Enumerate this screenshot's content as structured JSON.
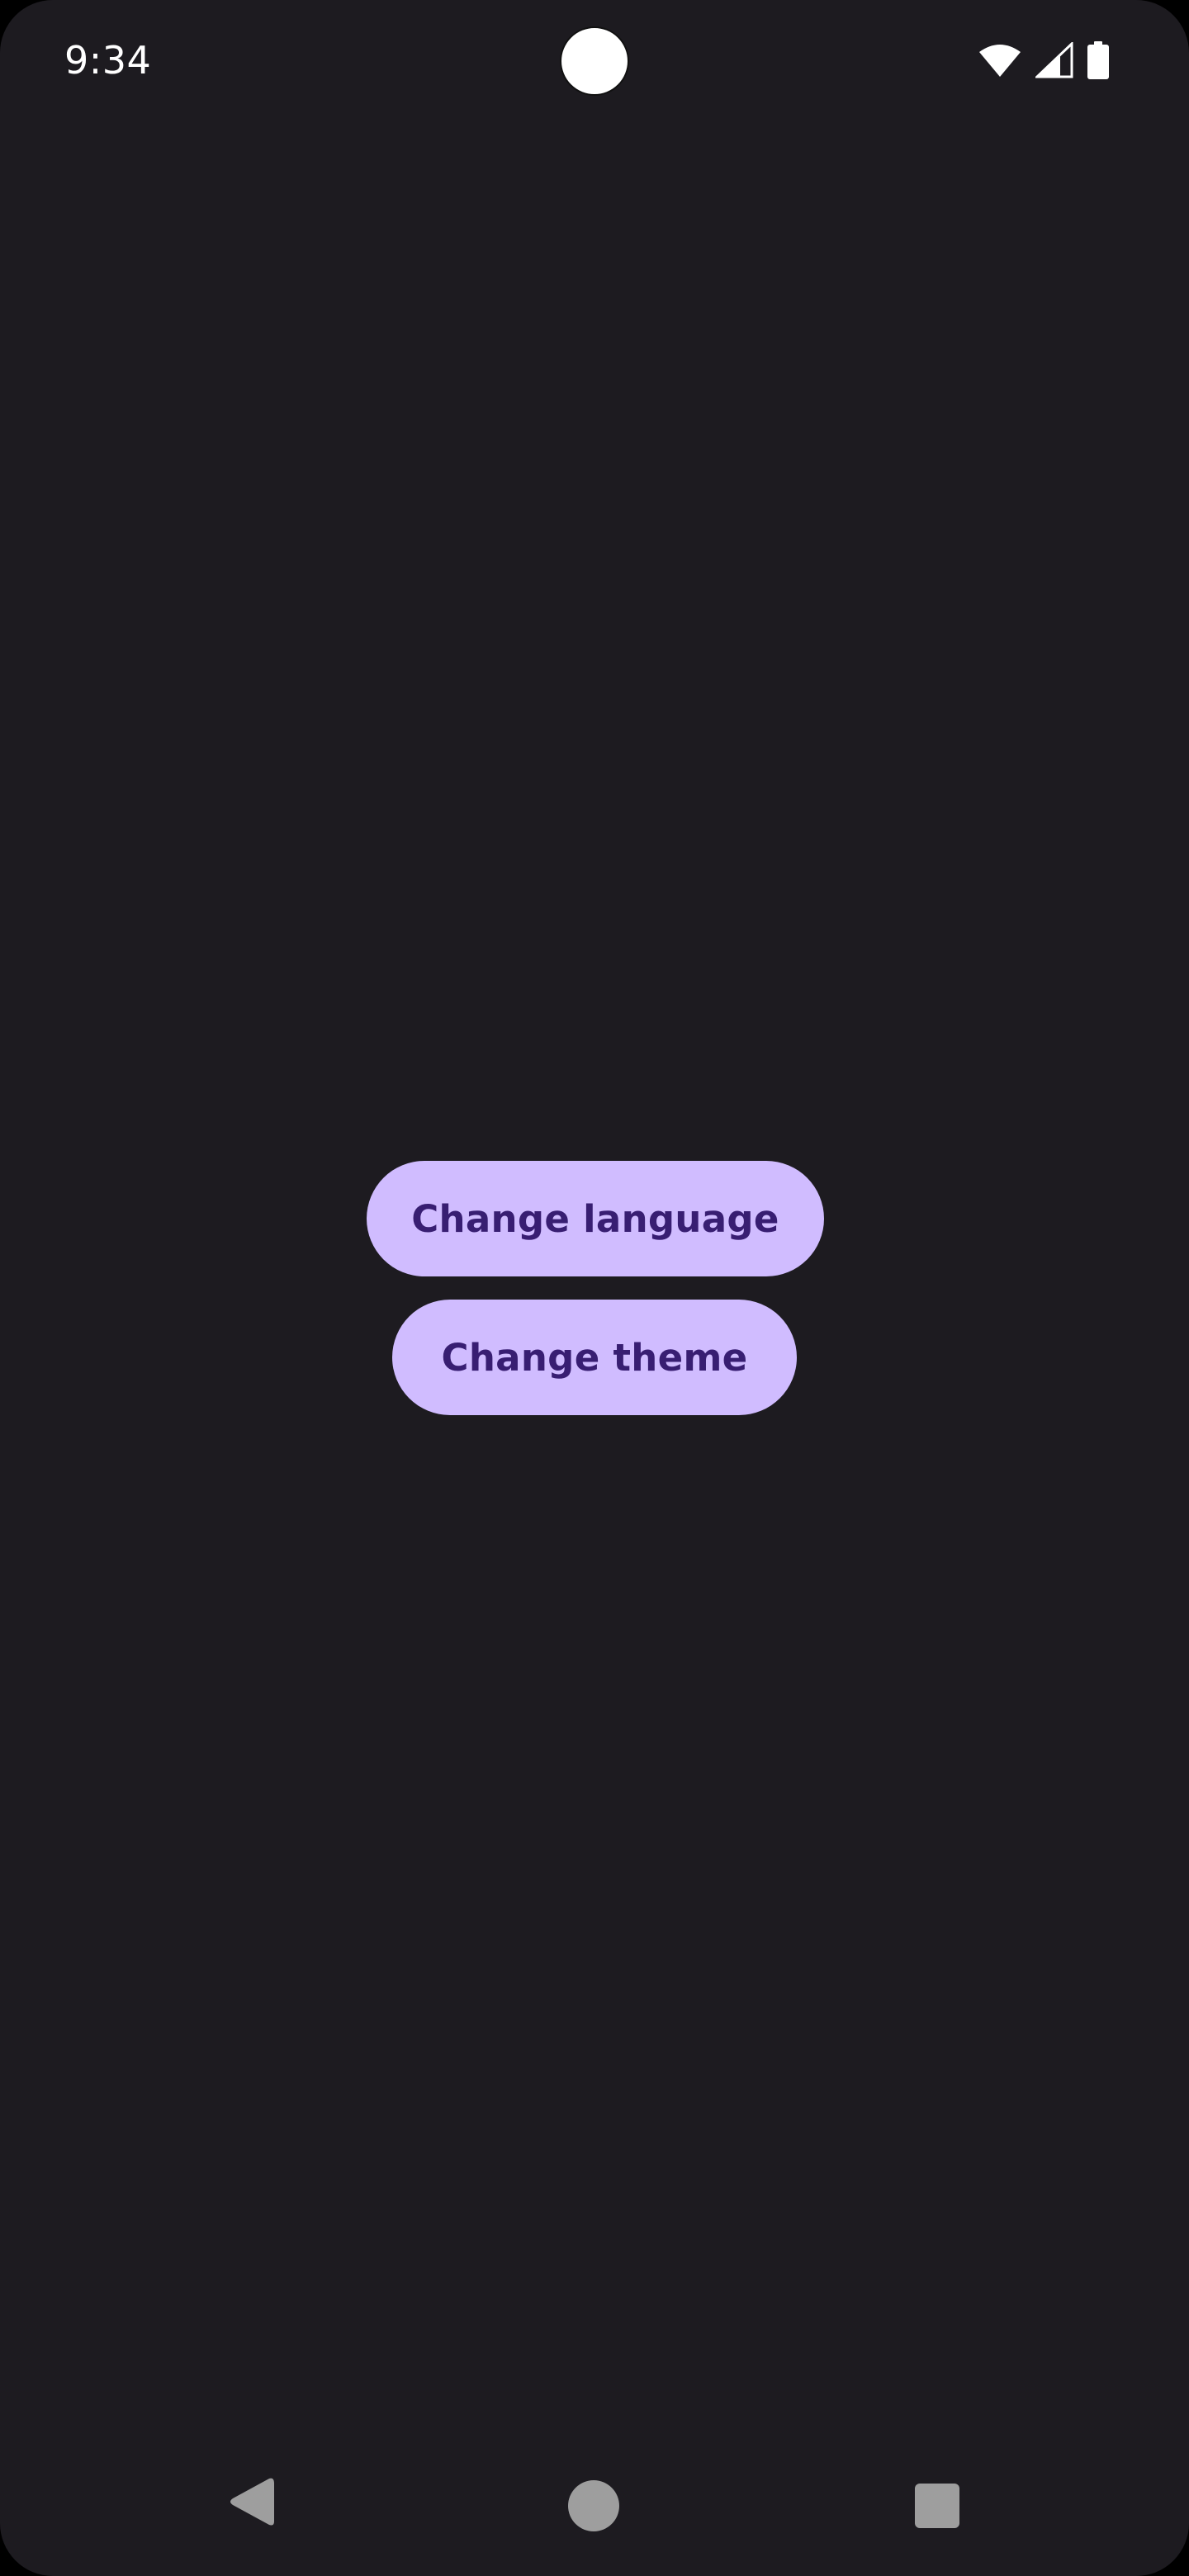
{
  "status_bar": {
    "time": "9:34",
    "icons": [
      "wifi-icon",
      "cellular-signal-icon",
      "battery-icon"
    ]
  },
  "main": {
    "buttons": [
      {
        "label": "Change language"
      },
      {
        "label": "Change theme"
      }
    ]
  },
  "nav_bar": {
    "icons": [
      "back-icon",
      "home-icon",
      "recents-icon"
    ]
  },
  "colors": {
    "background": "#1d1b20",
    "button_container": "#d0bcff",
    "button_text": "#381e72",
    "status_text": "#ffffff",
    "nav_icons": "#9e9e9e"
  }
}
